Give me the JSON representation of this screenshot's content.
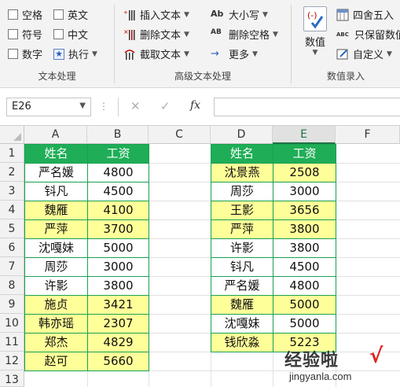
{
  "ribbon": {
    "text_group": {
      "label": "文本处理",
      "options": [
        {
          "label": "空格",
          "icon": "checkbox"
        },
        {
          "label": "英文",
          "icon": "checkbox"
        },
        {
          "label": "符号",
          "icon": "checkbox"
        },
        {
          "label": "中文",
          "icon": "checkbox"
        },
        {
          "label": "数字",
          "icon": "checkbox"
        },
        {
          "label": "执行",
          "icon": "execute-star-icon"
        }
      ]
    },
    "advanced_group": {
      "label": "高级文本处理",
      "items": [
        {
          "label": "插入文本",
          "icon": "insert-text-icon"
        },
        {
          "label": "删除文本",
          "icon": "delete-text-icon"
        },
        {
          "label": "截取文本",
          "icon": "extract-text-icon"
        },
        {
          "label": "大小写",
          "icon": "case-icon",
          "icon_text": "Ab"
        },
        {
          "label": "删除空格",
          "icon": "delete-space-icon",
          "icon_text": "AB"
        },
        {
          "label": "更多",
          "icon": "arrow-right-icon",
          "icon_text": "→"
        }
      ]
    },
    "number_group": {
      "label": "数值录入",
      "big_button": {
        "label": "数值",
        "icon": "numeric-icon"
      },
      "items": [
        {
          "label": "四舍五入",
          "icon": "round-icon"
        },
        {
          "label": "只保留数值",
          "icon": "keep-numbers-icon",
          "icon_text": "ABC"
        },
        {
          "label": "自定义",
          "icon": "custom-icon"
        }
      ]
    }
  },
  "formula_bar": {
    "name_box": "E26",
    "fx_label": "fx",
    "cancel_symbol": "✕",
    "confirm_symbol": "✓",
    "formula": ""
  },
  "grid": {
    "columns": [
      "A",
      "B",
      "C",
      "D",
      "E",
      "F"
    ],
    "selected_column": "E",
    "rows": [
      "1",
      "2",
      "3",
      "4",
      "5",
      "6",
      "7",
      "8",
      "9",
      "10",
      "11",
      "12",
      "13"
    ]
  },
  "table_left": {
    "headers": [
      "姓名",
      "工资"
    ],
    "rows": [
      {
        "name": "严名媛",
        "salary": "4800",
        "highlight": false
      },
      {
        "name": "钭凡",
        "salary": "4500",
        "highlight": false
      },
      {
        "name": "魏雁",
        "salary": "4100",
        "highlight": true
      },
      {
        "name": "严萍",
        "salary": "3700",
        "highlight": true
      },
      {
        "name": "沈嘎妹",
        "salary": "5000",
        "highlight": false
      },
      {
        "name": "周莎",
        "salary": "3000",
        "highlight": false
      },
      {
        "name": "许影",
        "salary": "3800",
        "highlight": false
      },
      {
        "name": "施贞",
        "salary": "3421",
        "highlight": true
      },
      {
        "name": "韩亦瑶",
        "salary": "2307",
        "highlight": true
      },
      {
        "name": "郑杰",
        "salary": "4829",
        "highlight": true
      },
      {
        "name": "赵可",
        "salary": "5660",
        "highlight": true
      }
    ]
  },
  "table_right": {
    "headers": [
      "姓名",
      "工资"
    ],
    "rows": [
      {
        "name": "沈景燕",
        "salary": "2508",
        "highlight": true
      },
      {
        "name": "周莎",
        "salary": "3000",
        "highlight": false
      },
      {
        "name": "王影",
        "salary": "3656",
        "highlight": true
      },
      {
        "name": "严萍",
        "salary": "3800",
        "highlight": true
      },
      {
        "name": "许影",
        "salary": "3800",
        "highlight": false
      },
      {
        "name": "钭凡",
        "salary": "4500",
        "highlight": false
      },
      {
        "name": "严名媛",
        "salary": "4800",
        "highlight": false
      },
      {
        "name": "魏雁",
        "salary": "5000",
        "highlight": true
      },
      {
        "name": "沈嘎妹",
        "salary": "5000",
        "highlight": false
      },
      {
        "name": "钱欣淼",
        "salary": "5223",
        "highlight": true
      }
    ]
  },
  "watermark": {
    "text": "经验啦",
    "check": "√",
    "url": "jingyanla.com"
  },
  "colors": {
    "header_green": "#1fae57",
    "highlight_yellow": "#ffff99",
    "border_green": "#1aa051",
    "excel_green": "#217346"
  }
}
